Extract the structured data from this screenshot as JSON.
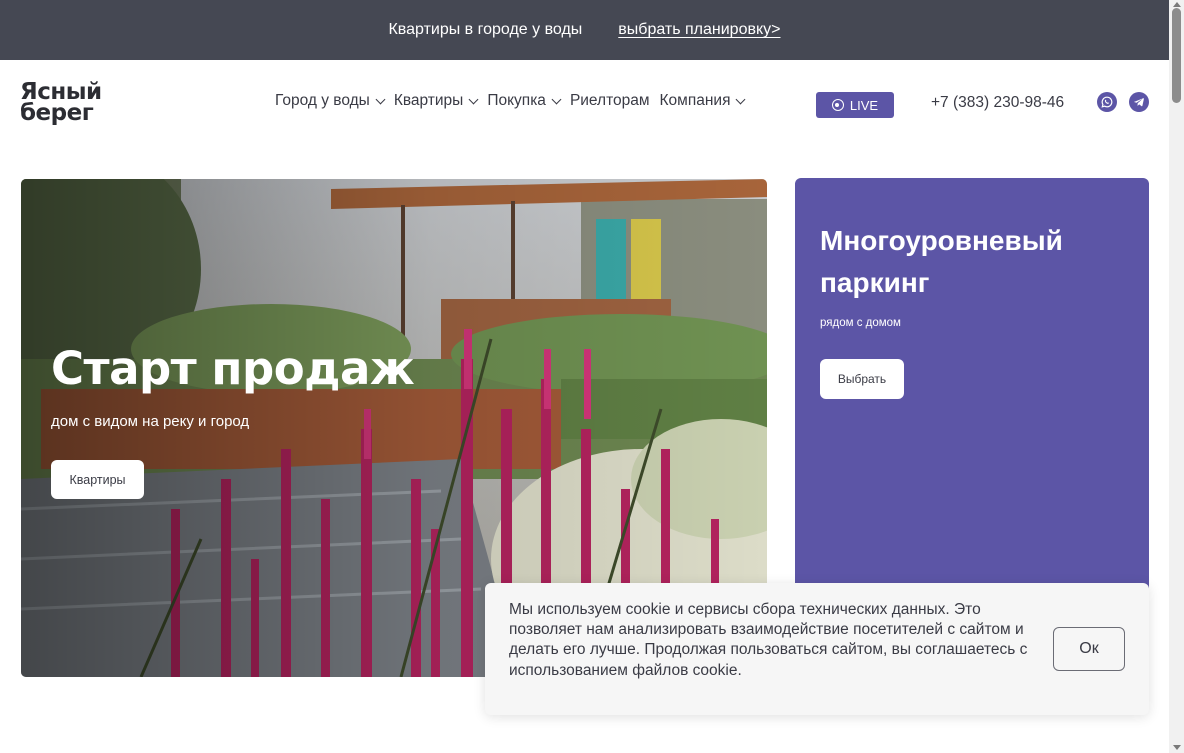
{
  "topbar": {
    "text": "Квартиры в городе у воды",
    "link": "выбрать планировку>"
  },
  "logo": {
    "line1": "Ясный",
    "line2": "берег"
  },
  "nav": {
    "items": [
      {
        "label": "Город у воды",
        "has_dropdown": true
      },
      {
        "label": "Квартиры",
        "has_dropdown": true
      },
      {
        "label": "Покупка",
        "has_dropdown": true
      },
      {
        "label": "Риелторам",
        "has_dropdown": false
      },
      {
        "label": "Компания",
        "has_dropdown": true
      }
    ],
    "live_label": "LIVE",
    "phone": "+7 (383) 230-98-46",
    "social": [
      "whatsapp-icon",
      "telegram-icon"
    ]
  },
  "hero": {
    "title": "Старт продаж",
    "subtitle": "дом с видом на реку и город",
    "button": "Квартиры"
  },
  "promo": {
    "title": "Многоуровневый паркинг",
    "subtitle": "рядом с домом",
    "button": "Выбрать"
  },
  "cookie": {
    "text": "Мы используем cookie и сервисы сбора технических данных. Это позволяет нам анализировать взаимодействие посетителей с сайтом и делать его лучше. Продолжая пользоваться сайтом, вы соглашаетесь с использованием файлов cookie.",
    "button": "Ок"
  },
  "colors": {
    "topbar_bg": "#454853",
    "accent": "#5c55a6",
    "text": "#3a3b45"
  }
}
